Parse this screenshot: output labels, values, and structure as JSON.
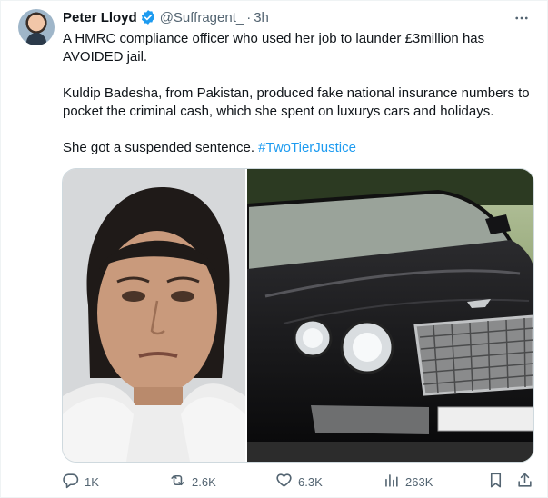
{
  "author": {
    "name": "Peter Lloyd",
    "handle": "@Suffragent_",
    "separator": "·",
    "time": "3h"
  },
  "tweet": {
    "line1": "A HMRC compliance officer who used her job to launder £3million has AVOIDED jail.",
    "line2": "Kuldip Badesha, from Pakistan, produced fake national insurance numbers to pocket the criminal cash, which she spent on luxurys cars and holidays.",
    "line3_text": "She got a suspended sentence. ",
    "hashtag": "#TwoTierJustice"
  },
  "media": {
    "left_icon": "mugshot-photo",
    "right_icon": "black-luxury-car-photo"
  },
  "actions": {
    "replies": "1K",
    "reposts": "2.6K",
    "likes": "6.3K",
    "views": "263K"
  },
  "colors": {
    "accent": "#1d9bf0",
    "text": "#0f1419",
    "muted": "#536471",
    "border": "#cfd9de"
  }
}
